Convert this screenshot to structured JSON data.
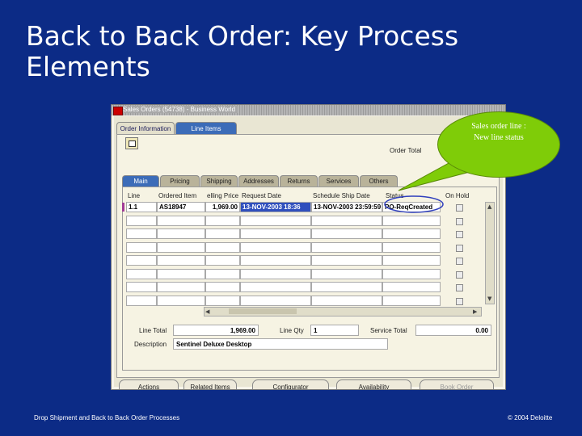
{
  "slide": {
    "title_line1": "Back to Back Order: Key Process",
    "title_line2": "Elements",
    "footer_left": "Drop Shipment and Back to Back Order Processes",
    "footer_right": "© 2004 Deloitte"
  },
  "window": {
    "title": "Sales Orders (54738) - Business World",
    "top_tabs": [
      "Order Information",
      "Line Items"
    ],
    "order_total_label": "Order Total",
    "sub_tabs": [
      "Main",
      "Pricing",
      "Shipping",
      "Addresses",
      "Returns",
      "Services",
      "Others"
    ],
    "columns": {
      "line": "Line",
      "ordered_item": "Ordered Item",
      "selling_price": "elling Price",
      "request_date": "Request Date",
      "schedule_ship_date": "Schedule Ship Date",
      "status": "Status",
      "on_hold": "On Hold"
    },
    "rows": [
      {
        "line": "1.1",
        "ordered_item": "AS18947",
        "selling_price": "1,969.00",
        "request_date": "13-NOV-2003 18:36",
        "schedule_ship_date": "13-NOV-2003 23:59:59",
        "status": "PO-ReqCreated"
      }
    ],
    "totals": {
      "line_total_label": "Line Total",
      "line_total_value": "1,969.00",
      "line_qty_label": "Line Qty",
      "line_qty_value": "1",
      "service_total_label": "Service Total",
      "service_total_value": "0.00",
      "description_label": "Description",
      "description_value": "Sentinel Deluxe Desktop"
    },
    "buttons": [
      "Actions",
      "Related Items",
      "Configurator",
      "Availability",
      "Book Order"
    ]
  },
  "callout": {
    "line1": "Sales order line :",
    "line2": "New line status"
  },
  "colors": {
    "background": "#0c2b86",
    "callout": "#7fcc08",
    "active_tab": "#3c6cb8",
    "selected_cell": "#2f4fbd"
  }
}
